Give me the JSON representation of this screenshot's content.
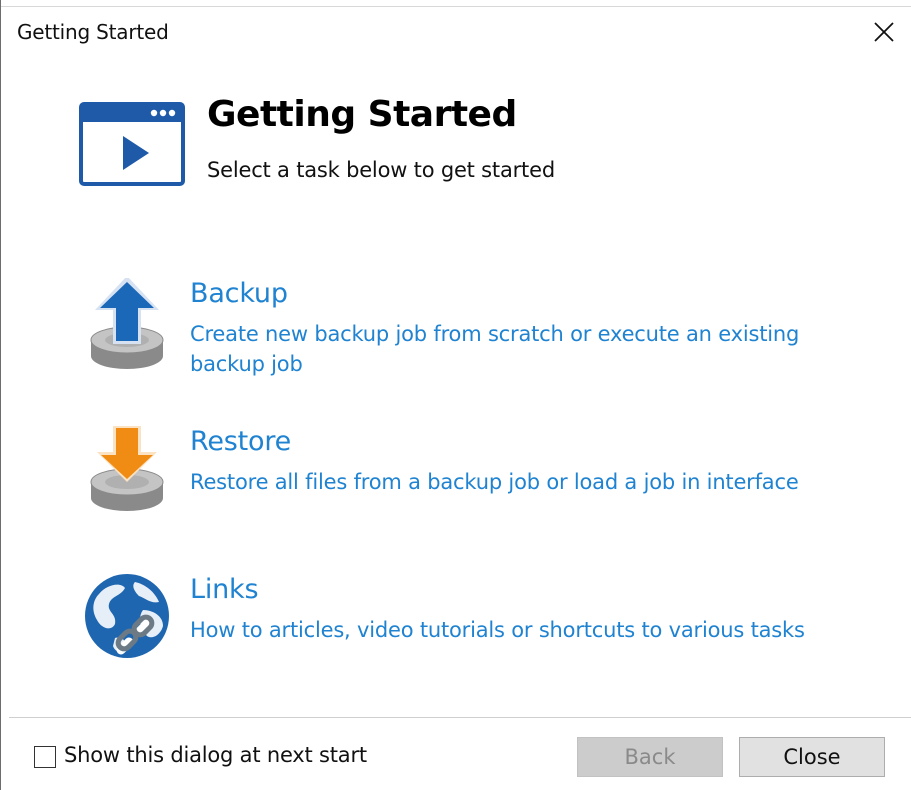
{
  "window": {
    "title": "Getting Started"
  },
  "header": {
    "title": "Getting Started",
    "subtitle": "Select a task below to get started"
  },
  "tasks": [
    {
      "title": "Backup",
      "description": "Create new backup job from scratch or execute an existing backup job",
      "icon": "backup-upload-icon",
      "accent": "#1b67b8"
    },
    {
      "title": "Restore",
      "description": "Restore all files from a backup job or load a job in interface",
      "icon": "restore-download-icon",
      "accent": "#f08c14"
    },
    {
      "title": "Links",
      "description": "How to articles, video tutorials or shortcuts to various tasks",
      "icon": "globe-link-icon",
      "accent": "#1f66b0"
    }
  ],
  "footer": {
    "checkbox_label": "Show this dialog at next start",
    "checkbox_checked": false,
    "back_label": "Back",
    "back_enabled": false,
    "close_label": "Close"
  },
  "colors": {
    "link": "#1f83d1",
    "icon_blue": "#1e5aa8"
  }
}
